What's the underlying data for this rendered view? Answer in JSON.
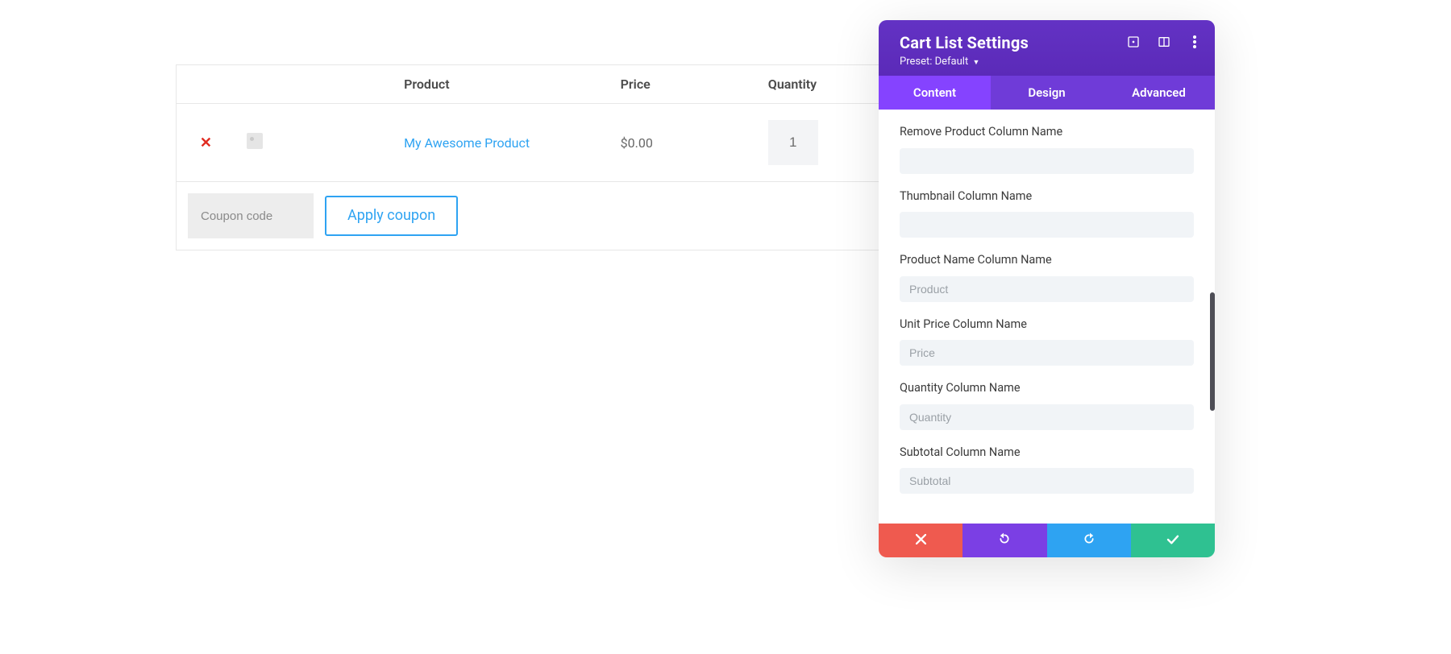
{
  "cart": {
    "headers": {
      "product": "Product",
      "price": "Price",
      "quantity": "Quantity"
    },
    "row": {
      "remove_glyph": "✕",
      "product_name": "My Awesome Product",
      "price": "$0.00",
      "qty": "1"
    },
    "coupon": {
      "placeholder": "Coupon code",
      "apply_label": "Apply coupon"
    }
  },
  "panel": {
    "title": "Cart List Settings",
    "preset_label": "Preset: Default",
    "tabs": {
      "content": "Content",
      "design": "Design",
      "advanced": "Advanced"
    },
    "fields": {
      "remove_col": {
        "label": "Remove Product Column Name",
        "placeholder": "",
        "value": ""
      },
      "thumb_col": {
        "label": "Thumbnail Column Name",
        "placeholder": "",
        "value": ""
      },
      "product_col": {
        "label": "Product Name Column Name",
        "placeholder": "Product",
        "value": ""
      },
      "price_col": {
        "label": "Unit Price Column Name",
        "placeholder": "Price",
        "value": ""
      },
      "qty_col": {
        "label": "Quantity Column Name",
        "placeholder": "Quantity",
        "value": ""
      },
      "subtotal_col": {
        "label": "Subtotal Column Name",
        "placeholder": "Subtotal",
        "value": ""
      }
    }
  }
}
